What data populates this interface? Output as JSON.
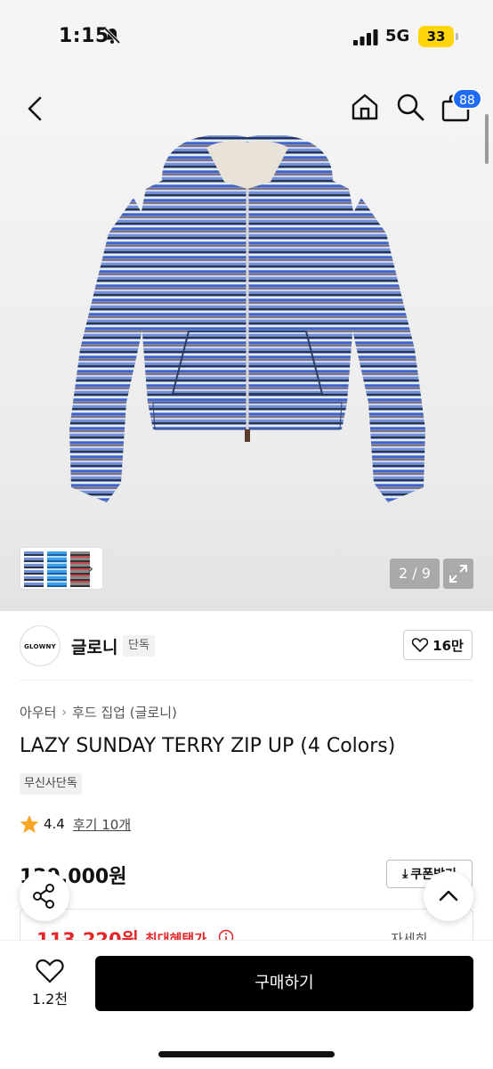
{
  "status_bar": {
    "time": "1:15",
    "network": "5G",
    "battery": "33"
  },
  "header": {
    "cart_count": "88"
  },
  "gallery": {
    "page_counter": "2 / 9"
  },
  "brand": {
    "logo_text": "GLOWNY",
    "name": "글로니",
    "exclusive_label": "단독",
    "like_count": "16만"
  },
  "breadcrumb": {
    "items": [
      "아우터",
      "후드 집업 (글로니)"
    ]
  },
  "product": {
    "title": "LAZY SUNDAY TERRY ZIP UP (4 Colors)",
    "tag": "무신사단독",
    "rating": "4.4",
    "reviews": "후기 10개",
    "price": "129,000원",
    "coupon_label": "쿠폰받기",
    "sale_price": "113,220원",
    "benefit_label": "최대혜택가",
    "detail_label": "자세히"
  },
  "bottom_bar": {
    "wish_count": "1.2천",
    "buy_label": "구매하기"
  },
  "colors": {
    "accent_blue": "#1e6bf5",
    "sale_red": "#e52528",
    "rating_star": "#f5a623"
  }
}
